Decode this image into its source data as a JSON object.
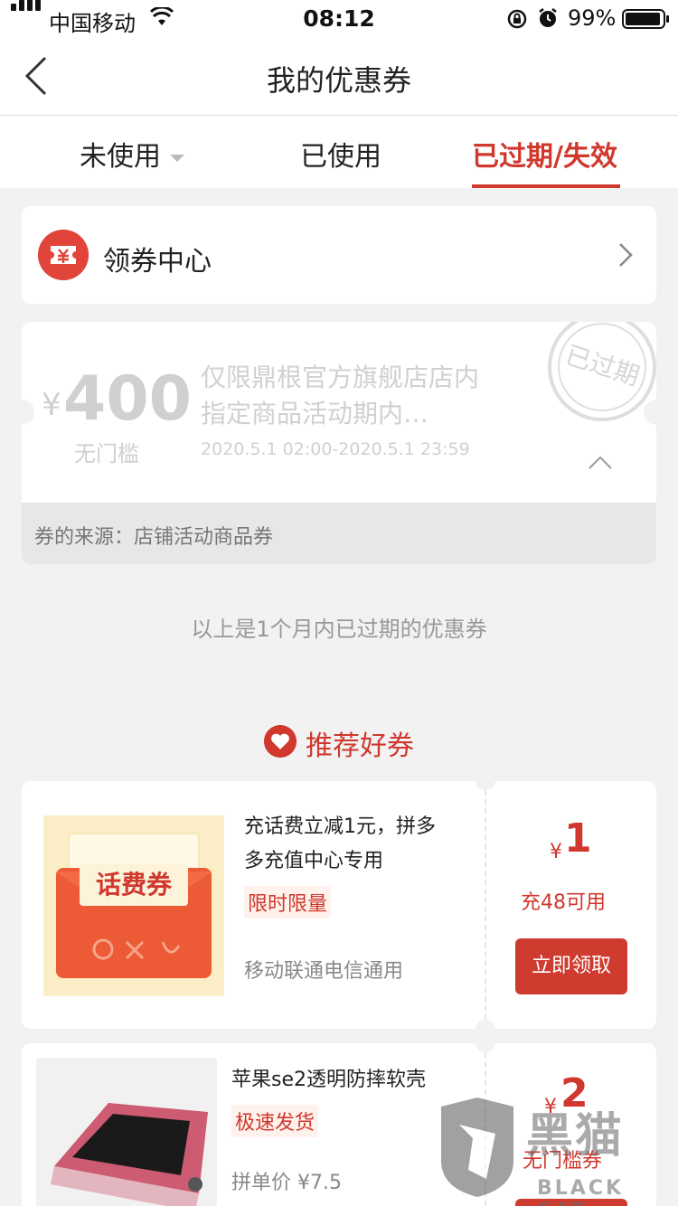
{
  "status_bar": {
    "carrier": "中国移动",
    "time": "08:12",
    "battery_pct": "99%"
  },
  "nav": {
    "title": "我的优惠券"
  },
  "tabs": [
    {
      "label": "未使用"
    },
    {
      "label": "已使用"
    },
    {
      "label": "已过期/失效",
      "active": true
    }
  ],
  "coupon_center": {
    "label": "领券中心"
  },
  "expired_coupon": {
    "currency": "¥",
    "amount": "400",
    "threshold": "无门槛",
    "description": "仅限鼎根官方旗舰店店内指定商品活动期内…",
    "dates": "2020.5.1 02:00-2020.5.1 23:59",
    "stamp_text": "已过期",
    "source": "券的来源：店铺活动商品券"
  },
  "note": "以上是1个月内已过期的优惠券",
  "recommend": {
    "title": "推荐好券",
    "items": [
      {
        "name": "充话费立减1元，拼多多充值中心专用",
        "tag": "限时限量",
        "sub": "移动联通电信通用",
        "thumb_text": "话费券",
        "currency": "¥",
        "amount": "1",
        "condition": "充48可用",
        "button": "立即领取"
      },
      {
        "name": "苹果se2透明防摔软壳",
        "tag": "极速发货",
        "sub": "拼单价 ¥7.5",
        "currency": "¥",
        "amount": "2",
        "condition": "无门槛券"
      }
    ]
  },
  "watermark": {
    "cn": "黑猫",
    "en": "BLACK CAT"
  },
  "colors": {
    "accent": "#d0382e",
    "background": "#f2f2f2"
  }
}
